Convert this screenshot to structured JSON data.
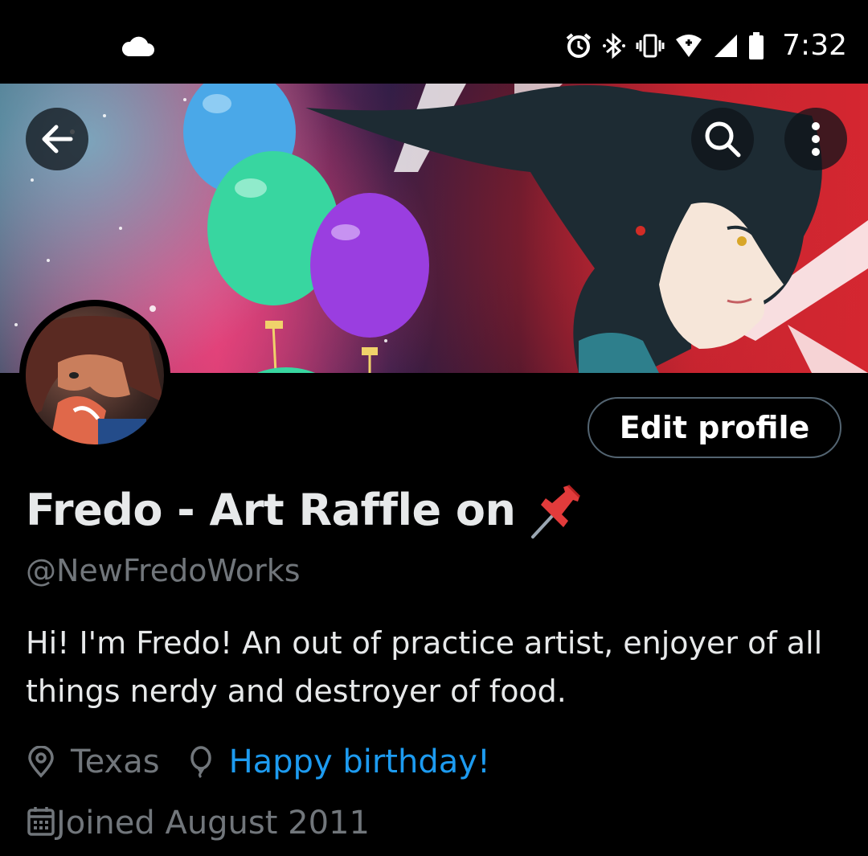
{
  "status_bar": {
    "time": "7:32",
    "icons": [
      "cloud-icon",
      "alarm-icon",
      "bluetooth-icon",
      "vibrate-icon",
      "wifi-icon",
      "signal-icon",
      "battery-icon"
    ]
  },
  "header": {
    "back_icon": "arrow-left-icon",
    "search_icon": "search-icon",
    "more_icon": "more-vertical-icon"
  },
  "profile": {
    "edit_label": "Edit profile",
    "display_name": "Fredo - Art Raffle on",
    "name_emoji": "pushpin-icon",
    "handle": "@NewFredoWorks",
    "bio": "Hi! I'm Fredo! An out of practice artist, enjoyer of all things nerdy and destroyer of food.",
    "location": "Texas",
    "birthday": "Happy birthday!",
    "joined": "Joined August 2011"
  },
  "colors": {
    "background": "#000000",
    "text_primary": "#e7e9ea",
    "text_secondary": "#71767b",
    "link": "#1d9bf0",
    "border": "#536471"
  }
}
